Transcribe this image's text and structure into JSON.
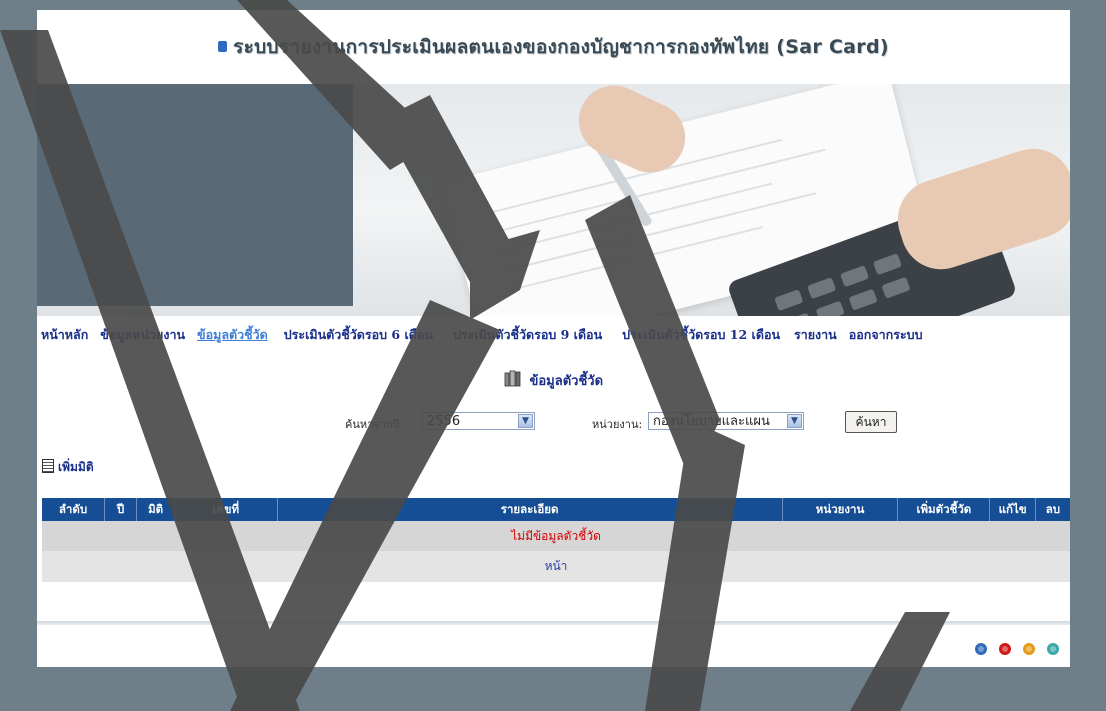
{
  "header": {
    "title": "ระบบรายงานการประเมินผลตนเองของกองบัญชาการกองทัพไทย (Sar Card)"
  },
  "nav": {
    "items": [
      {
        "label": "หน้าหลัก"
      },
      {
        "label": "ข้อมูลหน่วยงาน"
      },
      {
        "label": "ข้อมูลตัวชี้วัด",
        "active": true
      },
      {
        "label": "ประเมินตัวชี้วัดรอบ 6 เดือน"
      },
      {
        "label": "ประเมินตัวชี้วัดรอบ 9 เดือน"
      },
      {
        "label": "ประเมินตัวชี้วัดรอบ 12 เดือน"
      },
      {
        "label": "รายงาน"
      },
      {
        "label": "ออกจากระบบ"
      }
    ]
  },
  "section": {
    "title": "ข้อมูลตัวชี้วัด",
    "icon": "books-icon"
  },
  "filters": {
    "year_label": "ค้นหาจากปี :",
    "year_value": "2556",
    "unit_label": "หน่วยงาน:",
    "unit_value": "กองนโยบายและแผน",
    "search_button": "ค้นหา"
  },
  "actions": {
    "add_dimension": "เพิ่มมิติ"
  },
  "table": {
    "headers": [
      "ลำดับ",
      "ปี",
      "มิติ",
      "เลขที่",
      "รายละเอียด",
      "หน่วยงาน",
      "เพิ่มตัวชี้วัด",
      "แก้ไข",
      "ลบ"
    ],
    "empty_message": "ไม่มีข้อมูลตัวชี้วัด",
    "pager_label": "หน้า"
  },
  "colors": {
    "accent": "#154e94",
    "nav_text": "#1a2f8a",
    "empty_text": "#d40000",
    "dots": [
      "#2e6bb8",
      "#d01818",
      "#e69a1a",
      "#3aa8a8"
    ]
  }
}
